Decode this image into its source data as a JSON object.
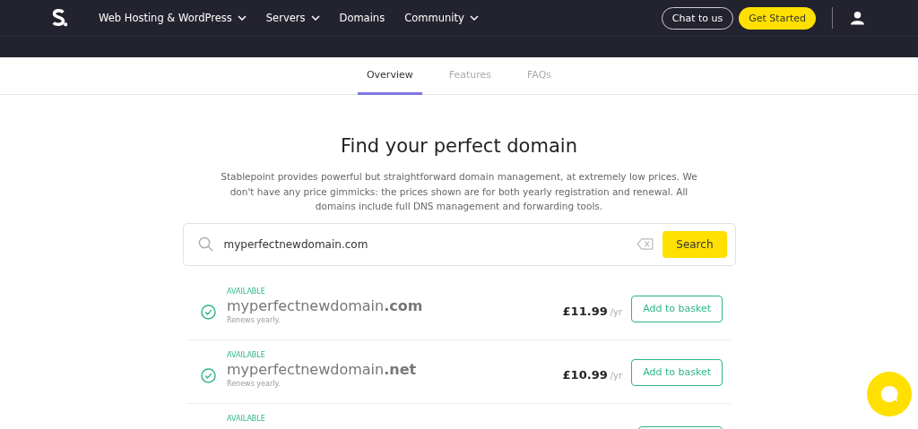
{
  "nav": {
    "items": [
      {
        "label": "Web Hosting & WordPress",
        "dropdown": true
      },
      {
        "label": "Servers",
        "dropdown": true
      },
      {
        "label": "Domains",
        "dropdown": false
      },
      {
        "label": "Community",
        "dropdown": true
      }
    ],
    "chat_button": "Chat to us",
    "cta_button": "Get Started"
  },
  "tabs": [
    {
      "label": "Overview",
      "selected": true
    },
    {
      "label": "Features",
      "selected": false
    },
    {
      "label": "FAQs",
      "selected": false
    }
  ],
  "heading": "Find your perfect domain",
  "intro": "Stablepoint provides powerful but straightforward domain management, at extremely low prices. We don't have any price gimmicks: the prices shown are for both yearly registration and renewal. All domains include full DNS management and forwarding tools.",
  "search": {
    "value": "myperfectnewdomain.com",
    "button": "Search"
  },
  "results": [
    {
      "status": "AVAILABLE",
      "available": true,
      "domain": "myperfectnewdomain**.com**",
      "note": "Renews yearly.",
      "price": "£11.99",
      "period": "/yr",
      "button": "Add to basket"
    },
    {
      "status": "AVAILABLE",
      "available": true,
      "domain": "myperfectnewdomain**.net**",
      "note": "Renews yearly.",
      "price": "£10.99",
      "period": "/yr",
      "button": "Add to basket"
    },
    {
      "status": "AVAILABLE"
    }
  ]
}
